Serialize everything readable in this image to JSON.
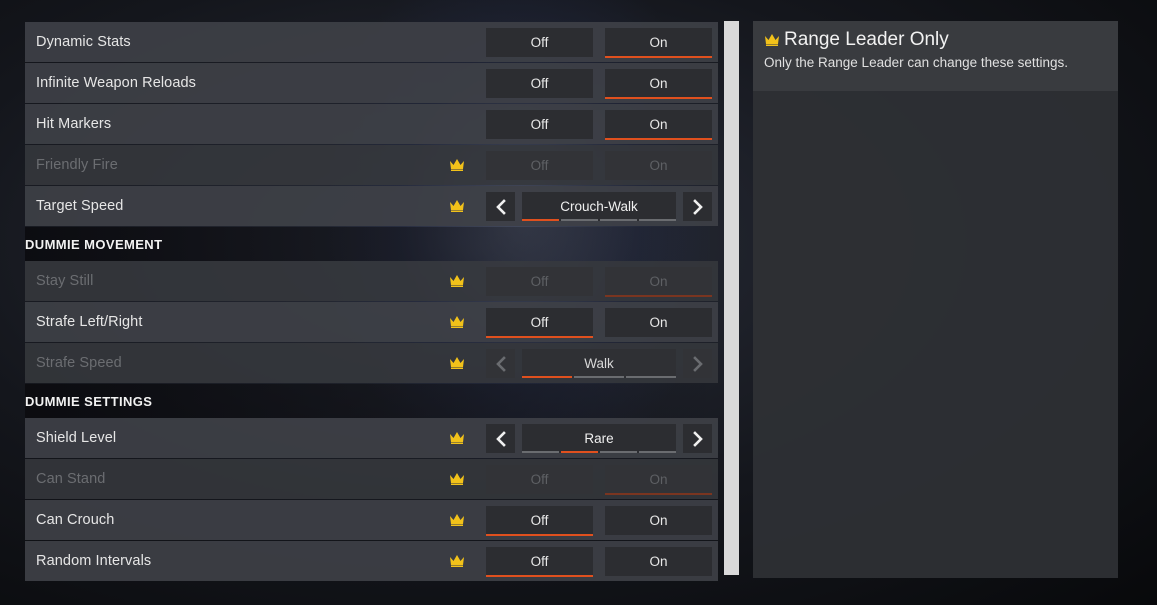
{
  "rows_top": [
    {
      "label": "Dynamic Stats",
      "type": "toggle",
      "off": "Off",
      "on": "On",
      "selected": "on",
      "disabled": false,
      "crown": false
    },
    {
      "label": "Infinite Weapon Reloads",
      "type": "toggle",
      "off": "Off",
      "on": "On",
      "selected": "on",
      "disabled": false,
      "crown": false
    },
    {
      "label": "Hit Markers",
      "type": "toggle",
      "off": "Off",
      "on": "On",
      "selected": "on",
      "disabled": false,
      "crown": false
    },
    {
      "label": "Friendly Fire",
      "type": "toggle",
      "off": "Off",
      "on": "On",
      "selected": "none",
      "disabled": true,
      "crown": true
    },
    {
      "label": "Target Speed",
      "type": "selector",
      "value": "Crouch-Walk",
      "segments": 4,
      "active_segment": 0,
      "disabled": false,
      "crown": true
    }
  ],
  "section_movement": {
    "title": "DUMMIE MOVEMENT",
    "rows": [
      {
        "label": "Stay Still",
        "type": "toggle",
        "off": "Off",
        "on": "On",
        "selected": "on",
        "disabled": true,
        "crown": true
      },
      {
        "label": "Strafe Left/Right",
        "type": "toggle",
        "off": "Off",
        "on": "On",
        "selected": "off",
        "disabled": false,
        "crown": true
      },
      {
        "label": "Strafe Speed",
        "type": "selector",
        "value": "Walk",
        "segments": 3,
        "active_segment": 0,
        "disabled": true,
        "crown": true
      }
    ]
  },
  "section_settings": {
    "title": "DUMMIE SETTINGS",
    "rows": [
      {
        "label": "Shield Level",
        "type": "selector",
        "value": "Rare",
        "segments": 4,
        "active_segment": 1,
        "disabled": false,
        "crown": true
      },
      {
        "label": "Can Stand",
        "type": "toggle",
        "off": "Off",
        "on": "On",
        "selected": "on",
        "disabled": true,
        "crown": true
      },
      {
        "label": "Can Crouch",
        "type": "toggle",
        "off": "Off",
        "on": "On",
        "selected": "off",
        "disabled": false,
        "crown": true
      },
      {
        "label": "Random Intervals",
        "type": "toggle",
        "off": "Off",
        "on": "On",
        "selected": "off",
        "disabled": false,
        "crown": true
      }
    ]
  },
  "info_panel": {
    "title": "Range Leader Only",
    "description": "Only the Range Leader can change these settings."
  },
  "colors": {
    "accent": "#e0501e",
    "crown": "#f2c21a"
  }
}
